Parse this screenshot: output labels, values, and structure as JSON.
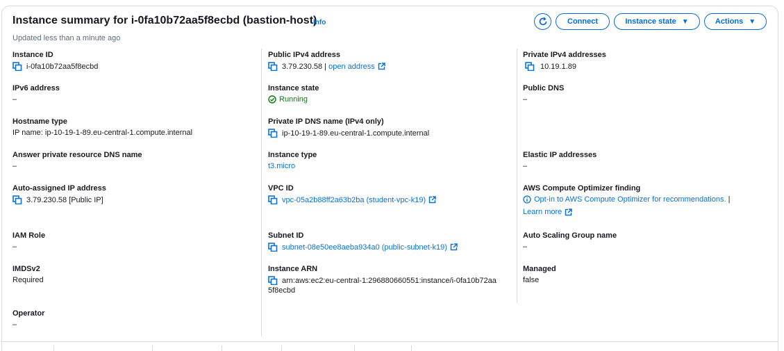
{
  "header": {
    "title": "Instance summary for i-0fa10b72aa5f8ecbd (bastion-host)",
    "info": "Info",
    "updated": "Updated less than a minute ago"
  },
  "buttons": {
    "connect": "Connect",
    "instance_state": "Instance state",
    "actions": "Actions"
  },
  "fields": {
    "instance_id": {
      "label": "Instance ID",
      "value": "i-0fa10b72aa5f8ecbd"
    },
    "public_ipv4": {
      "label": "Public IPv4 address",
      "value": "3.79.230.58 | ",
      "link": "open address"
    },
    "private_ipv4": {
      "label": "Private IPv4 addresses",
      "value": "10.19.1.89"
    },
    "ipv6": {
      "label": "IPv6 address",
      "value": "–"
    },
    "instance_state": {
      "label": "Instance state",
      "value": "Running"
    },
    "public_dns": {
      "label": "Public DNS",
      "value": "–"
    },
    "hostname_type": {
      "label": "Hostname type",
      "value": "IP name: ip-10-19-1-89.eu-central-1.compute.internal"
    },
    "private_ip_dns": {
      "label": "Private IP DNS name (IPv4 only)",
      "value": "ip-10-19-1-89.eu-central-1.compute.internal"
    },
    "answer_dns": {
      "label": "Answer private resource DNS name",
      "value": "–"
    },
    "instance_type": {
      "label": "Instance type",
      "value": "t3.micro"
    },
    "elastic_ip": {
      "label": "Elastic IP addresses",
      "value": "–"
    },
    "auto_ip": {
      "label": "Auto-assigned IP address",
      "value": "3.79.230.58 [Public IP]"
    },
    "vpc_id": {
      "label": "VPC ID",
      "value": "vpc-05a2b88ff2a63b2ba (student-vpc-k19)"
    },
    "optimizer": {
      "label": "AWS Compute Optimizer finding",
      "value": "Opt-in to AWS Compute Optimizer for recommendations.",
      "sep": " |",
      "learn_more": "Learn more"
    },
    "iam_role": {
      "label": "IAM Role",
      "value": "–"
    },
    "subnet_id": {
      "label": "Subnet ID",
      "value": "subnet-08e50ee8aeba934a0 (public-subnet-k19)"
    },
    "asg_name": {
      "label": "Auto Scaling Group name",
      "value": "–"
    },
    "imdsv2": {
      "label": "IMDSv2",
      "value": "Required"
    },
    "instance_arn": {
      "label": "Instance ARN",
      "value_line1": "arn:aws:ec2:eu-central-1:296880660551:instance/i-0fa10b72aa",
      "value_line2": "5f8ecbd"
    },
    "managed": {
      "label": "Managed",
      "value": "false"
    },
    "operator": {
      "label": "Operator",
      "value": "–"
    }
  },
  "colors": {
    "link": "#0972d3",
    "running": "#037f0c",
    "border": "#d5dbdb"
  },
  "icons": [
    "refresh-icon",
    "copy-icon",
    "external-link-icon",
    "check-circle-icon",
    "info-circle-icon",
    "caret-down-icon"
  ]
}
